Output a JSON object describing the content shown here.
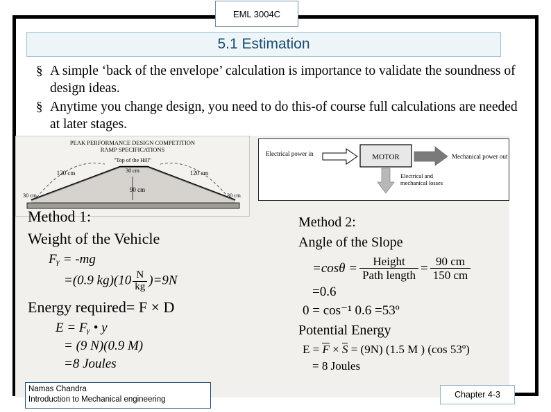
{
  "header": {
    "course_code": "EML 3004C"
  },
  "title": {
    "text": "5.1 Estimation"
  },
  "bullets": [
    {
      "marker": "§",
      "text": "A simple ‘back of the envelope’ calculation is importance to validate the soundness of design ideas."
    },
    {
      "marker": "§",
      "text": "Anytime you change design, you need to do this-of course full calculations are needed at later stages."
    }
  ],
  "ramp_figure": {
    "title_line1": "PEAK PERFORMANCE DESIGN COMPETITION",
    "title_line2": "RAMP SPECIFICATIONS",
    "label_top": "“Top of the Hill”",
    "label_left_slope": "120 cm",
    "label_right_slope": "120 cm",
    "label_top_width": "30 cm",
    "label_height": "90 cm",
    "label_left_base": "30 cm",
    "label_right_base": "30 cm"
  },
  "motor_figure": {
    "input_label": "Electrical power in",
    "box_label": "MOTOR",
    "output_label": "Mechanical power out",
    "loss_label_line1": "Electrical and",
    "loss_label_line2": "mechanical losses"
  },
  "method1": {
    "heading": "Method 1:",
    "subheading": "Weight of the Vehicle",
    "eq1": "Fᵧ = -mg",
    "eq2_prefix": "=(0.9 kg)(10",
    "eq2_frac_num": "N",
    "eq2_frac_den": "kg",
    "eq2_suffix": ")=9N",
    "eq3": "Energy required= F  ×  D",
    "eq4": "E = Fᵧ •  y",
    "eq5": "= (9 N)(0.9 M)",
    "eq6": "=8 Joules"
  },
  "method2": {
    "heading": "Method 2:",
    "subheading": "Angle of the Slope",
    "eq1_prefix": "=cosθ =",
    "eq1_frac1_num": "Height",
    "eq1_frac1_den": "Path length",
    "eq1_equals": "=",
    "eq1_frac2_num": "90 cm",
    "eq1_frac2_den": "150 cm",
    "eq2": "=0.6",
    "eq3": "0 = cos⁻¹ 0.6 =53º",
    "subheading2": "Potential Energy",
    "eq4_prefix": "E =",
    "eq4_fbar": "F",
    "eq4_times": "×",
    "eq4_sbar": "S",
    "eq4_suffix": "=  (9N)  (1.5 M )  (cos  53º)",
    "eq5": "= 8 Joules"
  },
  "footer": {
    "author": "Namas Chandra",
    "course": "Introduction to Mechanical engineering",
    "chapter": "Chapter 4-3"
  }
}
